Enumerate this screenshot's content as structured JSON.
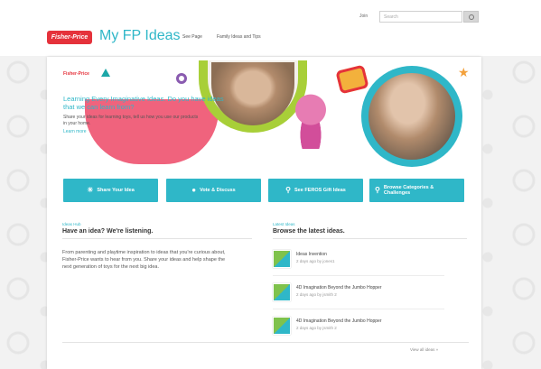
{
  "header": {
    "logo_text": "Fisher-Price",
    "site_title": "My FP Ideas",
    "nav": [
      "See Page",
      "Family Ideas and Tips"
    ],
    "sign_in": "Join",
    "search_placeholder": "Search"
  },
  "hero": {
    "tagline": "Fisher-Price",
    "headline": "Learning Every Imaginative Ideas. Do you have ideas that we can learn from?",
    "body": "Share your ideas for learning toys, tell us how you use our products in your home.",
    "more": "Learn more"
  },
  "cta_buttons": [
    {
      "label": "Share Your Idea",
      "icon": "lightbulb-icon"
    },
    {
      "label": "Vote & Discuss",
      "icon": "chat-icon"
    },
    {
      "label": "See FEROS Gift Ideas",
      "icon": "search-icon"
    },
    {
      "label": "Browse Categories & Challenges",
      "icon": "search-icon"
    }
  ],
  "left_column": {
    "label": "Ideas Hub",
    "title": "Have an idea? We're listening.",
    "body": "From parenting and playtime inspiration to ideas that you're curious about, Fisher-Price wants to hear from you. Share your ideas and help shape the next generation of toys for the next big idea."
  },
  "right_column": {
    "label": "Latest Ideas",
    "title": "Browse the latest ideas.",
    "ideas": [
      {
        "title": "Ideas Invention",
        "meta": "2 days ago by jones1"
      },
      {
        "title": "4D Imagination Beyond the Jumbo Hopper",
        "meta": "2 days ago by jsmith 2"
      },
      {
        "title": "4D Imagination Beyond the Jumbo Hopper",
        "meta": "2 days ago by jsmith 2"
      }
    ],
    "view_all": "View all ideas »"
  },
  "colors": {
    "brand_red": "#e5323b",
    "teal": "#2fb7c8",
    "pink": "#f0637d",
    "green": "#a8cf38"
  }
}
